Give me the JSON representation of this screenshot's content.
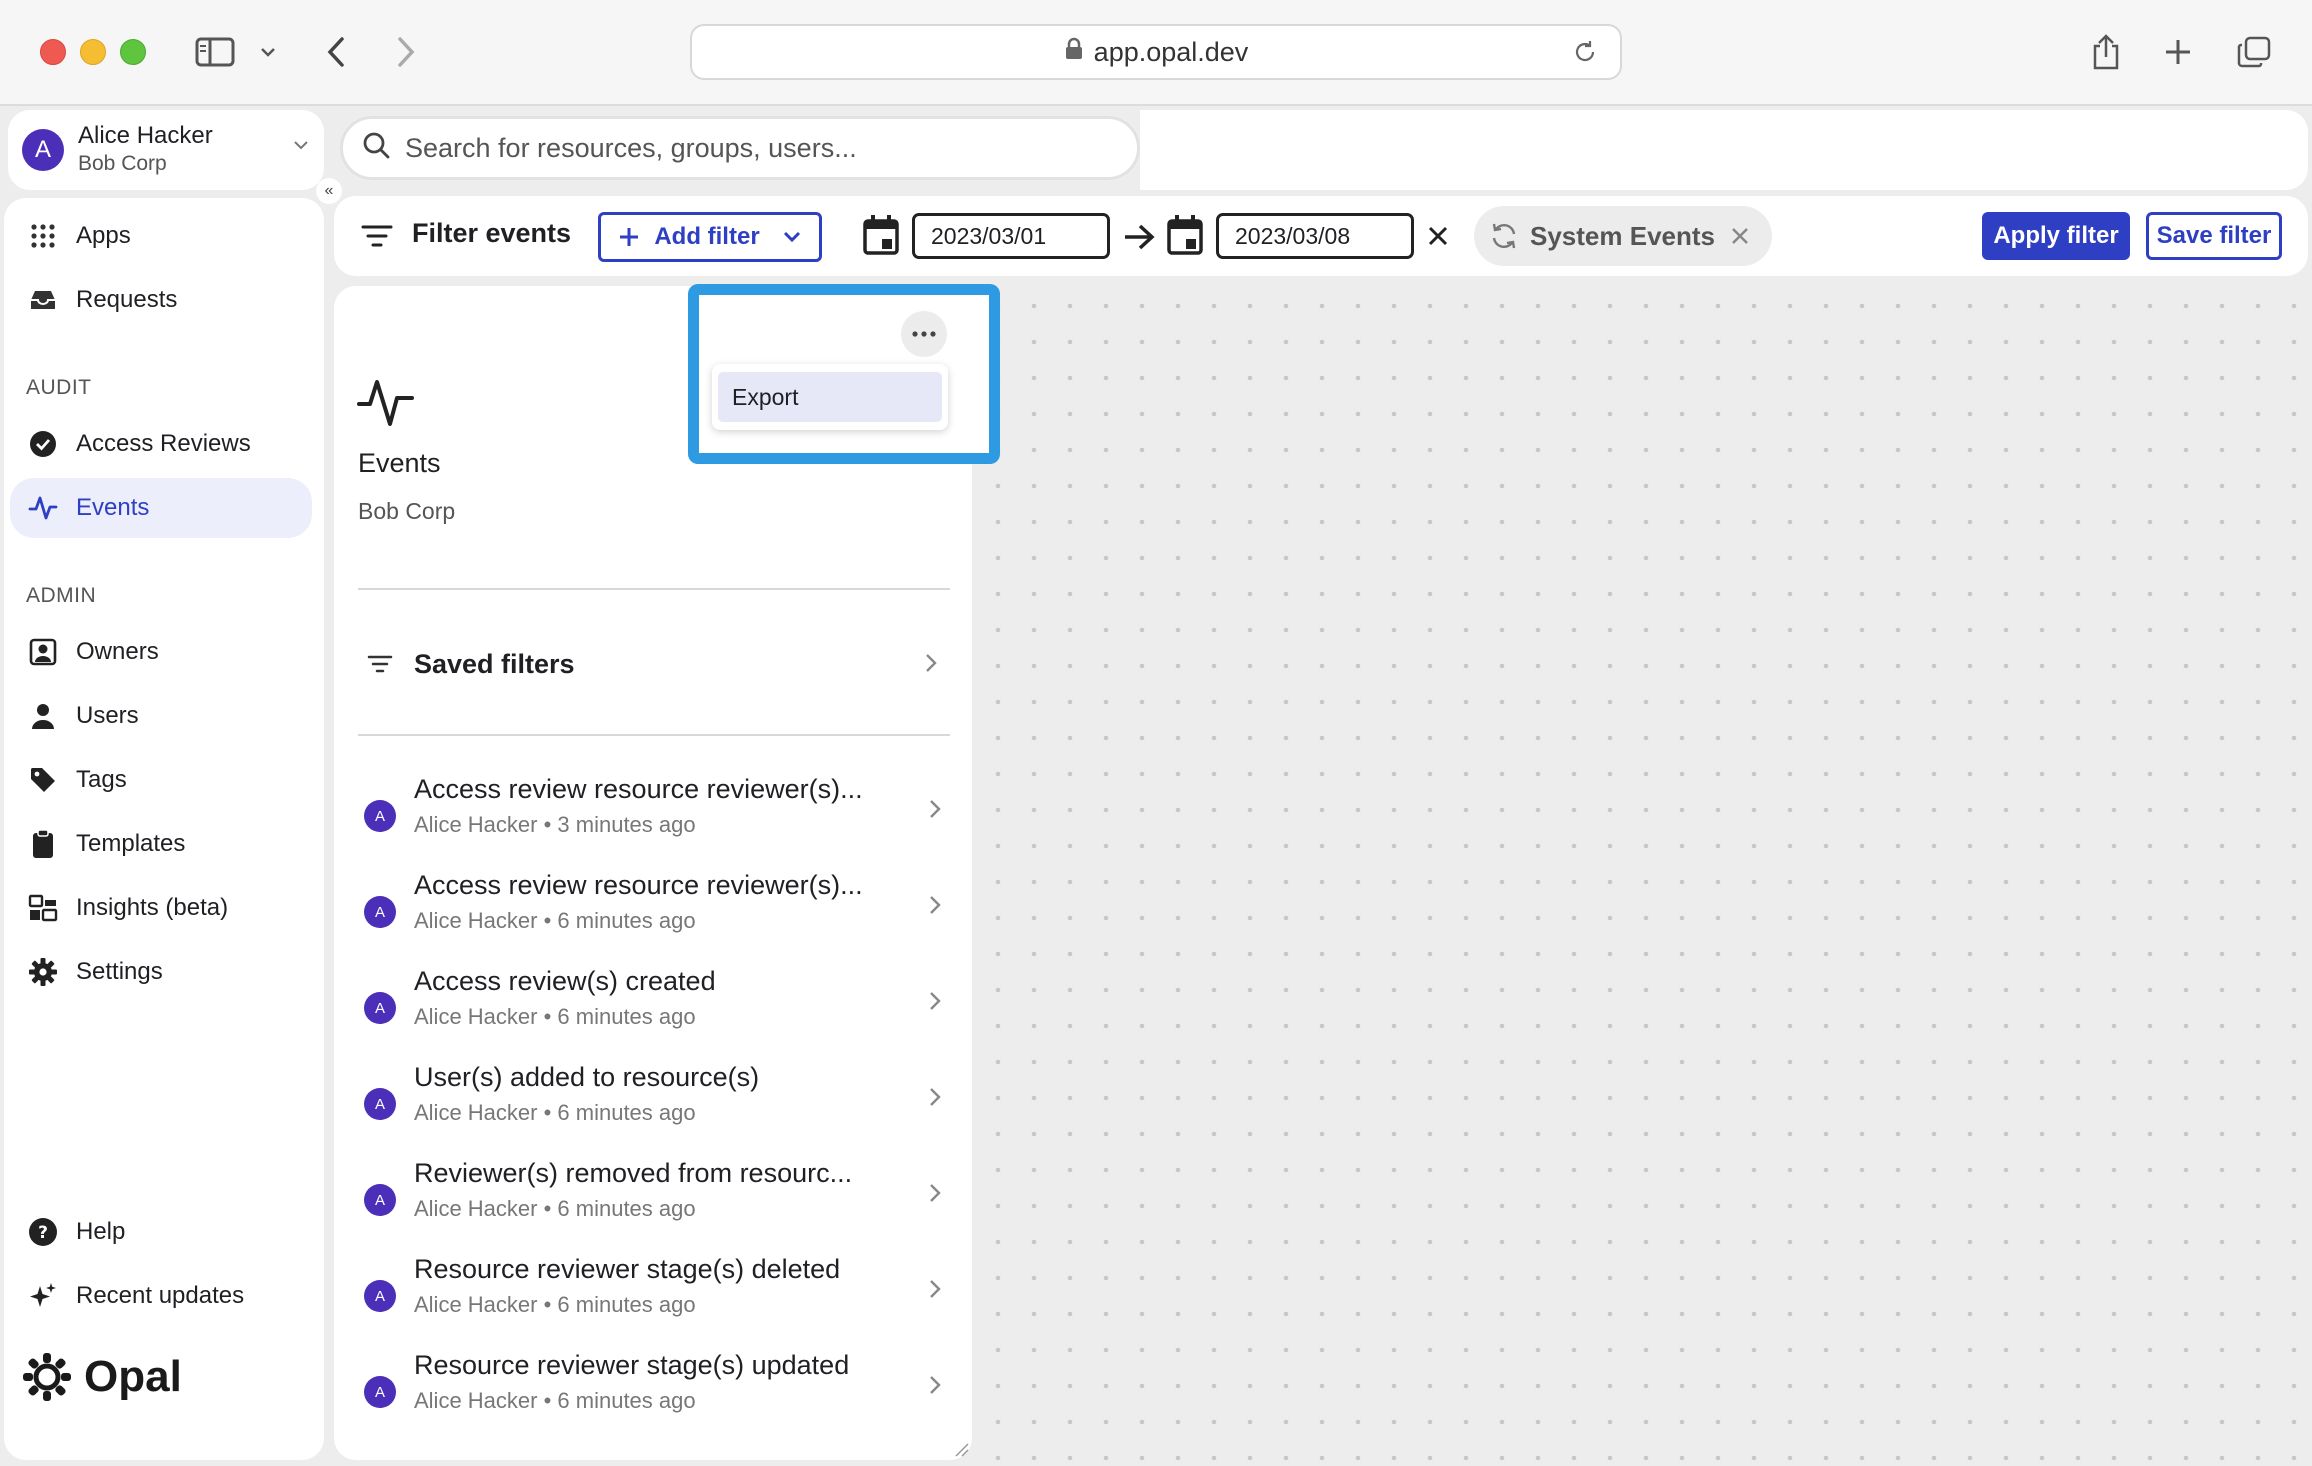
{
  "browser": {
    "url": "app.opal.dev"
  },
  "user": {
    "initial": "A",
    "name": "Alice Hacker",
    "org": "Bob Corp"
  },
  "collapse_label": "«",
  "search": {
    "placeholder": "Search for resources, groups, users..."
  },
  "sidebar": {
    "items_top": [
      {
        "label": "Apps",
        "icon": "apps-grid-icon"
      },
      {
        "label": "Requests",
        "icon": "inbox-icon"
      }
    ],
    "audit_label": "AUDIT",
    "audit_items": [
      {
        "label": "Access Reviews",
        "icon": "check-circle-icon"
      },
      {
        "label": "Events",
        "icon": "activity-icon",
        "active": true
      }
    ],
    "admin_label": "ADMIN",
    "admin_items": [
      {
        "label": "Owners",
        "icon": "owner-icon"
      },
      {
        "label": "Users",
        "icon": "user-icon"
      },
      {
        "label": "Tags",
        "icon": "tag-icon"
      },
      {
        "label": "Templates",
        "icon": "clipboard-icon"
      },
      {
        "label": "Insights (beta)",
        "icon": "insights-icon"
      },
      {
        "label": "Settings",
        "icon": "gear-icon"
      }
    ],
    "bottom_items": [
      {
        "label": "Help",
        "icon": "help-icon"
      },
      {
        "label": "Recent updates",
        "icon": "sparkle-icon"
      }
    ],
    "logo_text": "Opal"
  },
  "filterbar": {
    "title": "Filter events",
    "add_filter": "Add filter",
    "start_date": "2023/03/01",
    "end_date": "2023/03/08",
    "chip_label": "System Events",
    "apply": "Apply filter",
    "save": "Save filter"
  },
  "panel": {
    "title": "Events",
    "subtitle": "Bob Corp",
    "saved_filters": "Saved filters",
    "menu_export": "Export",
    "events": [
      {
        "title": "Access review resource reviewer(s)...",
        "meta": "Alice Hacker • 3 minutes ago",
        "initial": "A"
      },
      {
        "title": "Access review resource reviewer(s)...",
        "meta": "Alice Hacker • 6 minutes ago",
        "initial": "A"
      },
      {
        "title": "Access review(s) created",
        "meta": "Alice Hacker • 6 minutes ago",
        "initial": "A"
      },
      {
        "title": "User(s) added to resource(s)",
        "meta": "Alice Hacker • 6 minutes ago",
        "initial": "A"
      },
      {
        "title": "Reviewer(s) removed from resourc...",
        "meta": "Alice Hacker • 6 minutes ago",
        "initial": "A"
      },
      {
        "title": "Resource reviewer stage(s) deleted",
        "meta": "Alice Hacker • 6 minutes ago",
        "initial": "A"
      },
      {
        "title": "Resource reviewer stage(s) updated",
        "meta": "Alice Hacker • 6 minutes ago",
        "initial": "A"
      }
    ]
  },
  "colors": {
    "accent": "#2f3fc4",
    "avatar": "#4b2fb8",
    "highlight": "#2e9ae2"
  }
}
